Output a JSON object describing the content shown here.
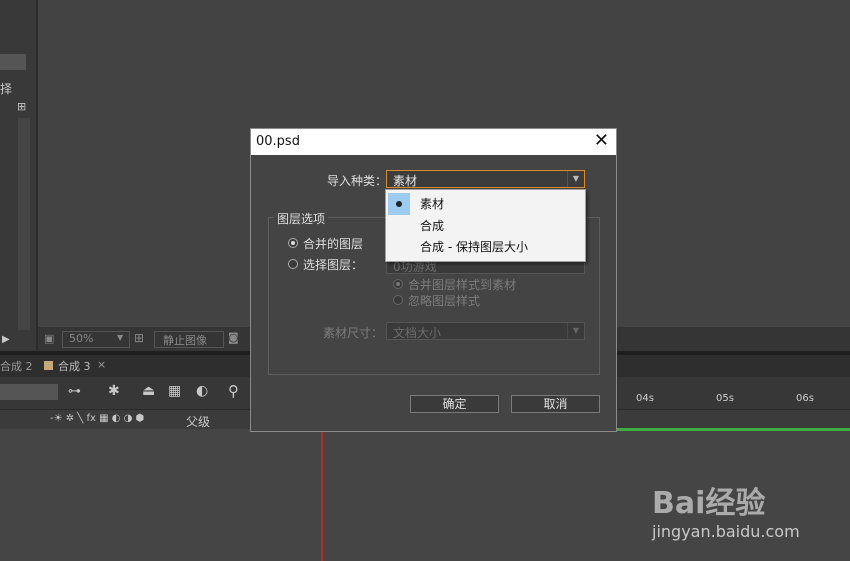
{
  "left_panel": {
    "partial_label": "择"
  },
  "viewer_bar": {
    "zoom": "50%",
    "still_image": "静止图像"
  },
  "timeline": {
    "tabs": [
      "合成 2",
      "合成 3"
    ],
    "tab_close": "×",
    "parent_label": "父级",
    "ticks": [
      "04s",
      "05s",
      "06s"
    ]
  },
  "dialog": {
    "title": "00.psd",
    "close": "✕",
    "import_kind_label": "导入种类：",
    "import_kind_value": "素材",
    "layer_options_title": "图层选项",
    "merged_layers": "合并的图层",
    "choose_layer": "选择图层：",
    "choose_layer_value": "0功游戏",
    "merge_style": "合并图层样式到素材",
    "ignore_style": "忽略图层样式",
    "footage_size_label": "素材尺寸：",
    "footage_size_value": "文档大小",
    "ok": "确定",
    "cancel": "取消"
  },
  "dropdown": {
    "options": [
      "素材",
      "合成",
      "合成 - 保持图层大小"
    ],
    "selected": "素材"
  },
  "watermark": {
    "brand": "Bai经验",
    "url": "jingyan.baidu.com"
  }
}
